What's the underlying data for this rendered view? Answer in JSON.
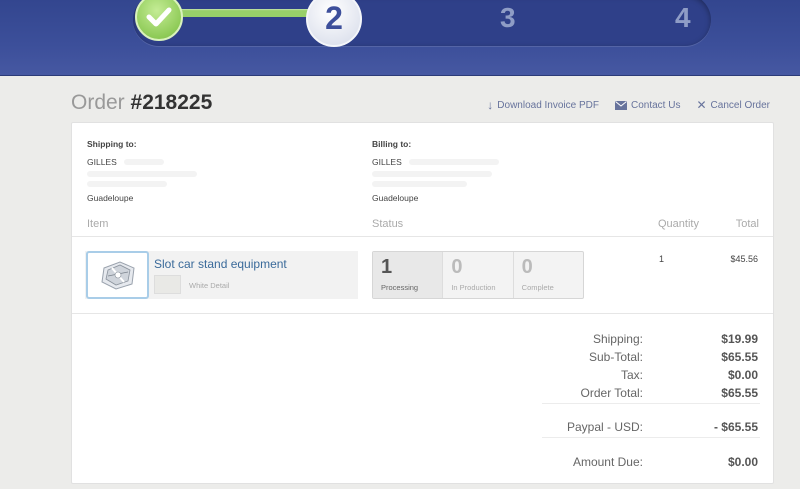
{
  "stepper": {
    "active_step": "2",
    "step3": "3",
    "step4": "4"
  },
  "order": {
    "title_prefix": "Order ",
    "number": "#218225"
  },
  "actions": {
    "download": "Download Invoice PDF",
    "contact": "Contact Us",
    "cancel": "Cancel Order"
  },
  "shipping": {
    "label": "Shipping to:",
    "name": "GILLES",
    "country": "Guadeloupe"
  },
  "billing": {
    "label": "Billing to:",
    "name": "GILLES",
    "country": "Guadeloupe"
  },
  "columns": {
    "item": "Item",
    "status": "Status",
    "quantity": "Quantity",
    "total": "Total"
  },
  "item": {
    "name": "Slot car stand equipment",
    "detail": "White Detail",
    "quantity": "1",
    "total": "$45.56"
  },
  "status": [
    {
      "count": "1",
      "label": "Processing"
    },
    {
      "count": "0",
      "label": "In Production"
    },
    {
      "count": "0",
      "label": "Complete"
    }
  ],
  "totals": {
    "shipping_label": "Shipping:",
    "shipping": "$19.99",
    "subtotal_label": "Sub-Total:",
    "subtotal": "$65.55",
    "tax_label": "Tax:",
    "tax": "$0.00",
    "order_total_label": "Order Total:",
    "order_total": "$65.55",
    "paypal_label": "Paypal - USD:",
    "paypal": "- $65.55",
    "amount_due_label": "Amount Due:",
    "amount_due": "$0.00"
  },
  "colors": {
    "header": "#3c4f9a",
    "complete_step": "#98d069",
    "link": "#3a6a9a"
  }
}
